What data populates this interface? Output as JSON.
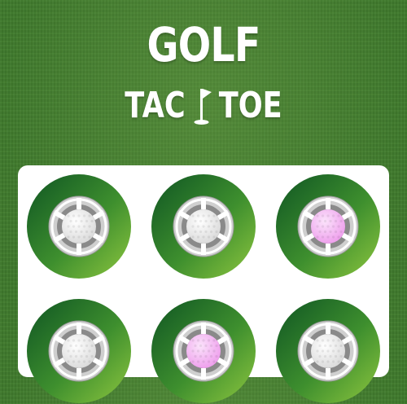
{
  "title": {
    "line1": "GOLF",
    "line2_left": "TAC",
    "line2_right": "TOE"
  },
  "colors": {
    "grass": "#3f7a2c",
    "board": "#ffffff",
    "ring_dark": "#1f6b2a",
    "ring_light": "#8dc63f",
    "white_ball": "#ffffff",
    "pink_ball": "#f2b3f0"
  },
  "board": {
    "cells": [
      {
        "ball": "white"
      },
      {
        "ball": "white"
      },
      {
        "ball": "pink"
      },
      {
        "ball": "white"
      },
      {
        "ball": "pink"
      },
      {
        "ball": "white"
      }
    ]
  }
}
